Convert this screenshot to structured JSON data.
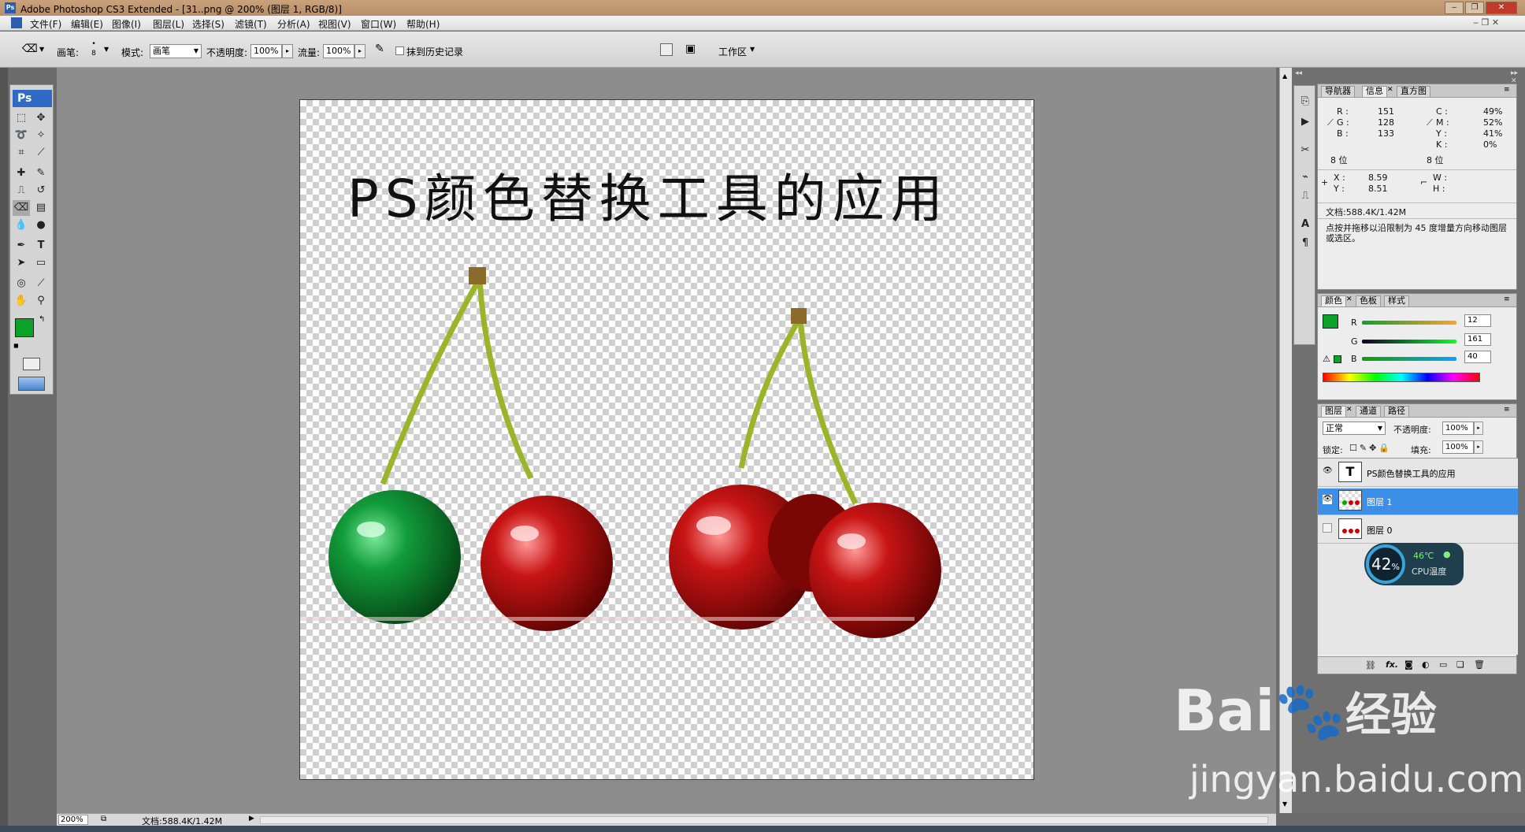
{
  "window": {
    "title": "Adobe Photoshop CS3 Extended - [31..png @ 200% (图层 1, RGB/8)]",
    "app_icon": "Ps",
    "buttons": [
      "‒",
      "❐",
      "✕"
    ]
  },
  "menu": [
    "文件(F)",
    "编辑(E)",
    "图像(I)",
    "图层(L)",
    "选择(S)",
    "滤镜(T)",
    "分析(A)",
    "视图(V)",
    "窗口(W)",
    "帮助(H)"
  ],
  "options": {
    "brush_label": "画笔:",
    "brush_size": "8",
    "mode_label": "模式:",
    "mode_value": "画笔",
    "opacity_label": "不透明度:",
    "opacity_value": "100%",
    "flow_label": "流量:",
    "flow_value": "100%",
    "erase_history_label": "抹到历史记录",
    "workspace_label": "工作区"
  },
  "toolbox": {
    "badge": "Ps"
  },
  "canvas": {
    "heading": "PS颜色替换工具的应用"
  },
  "status": {
    "zoom": "200%",
    "doc": "文档:588.4K/1.42M"
  },
  "info_panel": {
    "tabs": [
      "导航器",
      "信息",
      "直方图"
    ],
    "r_label": "R :",
    "r_value": "151",
    "g_label": "G :",
    "g_value": "128",
    "b_label": "B :",
    "b_value": "133",
    "c_label": "C :",
    "c_value": "49%",
    "m_label": "M :",
    "m_value": "52%",
    "y_label": "Y :",
    "y_value": "41%",
    "k_label": "K :",
    "k_value": "0%",
    "bits_left": "8 位",
    "bits_right": "8 位",
    "x_label": "X :",
    "x_value": "8.59",
    "y2_label": "Y :",
    "y2_value": "8.51",
    "w_label": "W :",
    "h_label": "H :",
    "doc": "文档:588.4K/1.42M",
    "hint": "点按并拖移以沿限制为 45 度增量方向移动图层或选区。"
  },
  "color_panel": {
    "tabs": [
      "颜色",
      "色板",
      "样式"
    ],
    "r_label": "R",
    "r_value": "12",
    "g_label": "G",
    "g_value": "161",
    "b_label": "B",
    "b_value": "40",
    "foreground": "#0ca128"
  },
  "layers_panel": {
    "tabs": [
      "图层",
      "通道",
      "路径"
    ],
    "blend_mode": "正常",
    "opacity_label": "不透明度:",
    "opacity_value": "100%",
    "lock_label": "锁定:",
    "fill_label": "填充:",
    "fill_value": "100%",
    "layers": [
      {
        "name": "PS颜色替换工具的应用",
        "type": "text",
        "visible": true,
        "selected": false
      },
      {
        "name": "图层 1",
        "type": "pixel",
        "visible": true,
        "selected": true
      },
      {
        "name": "图层 0",
        "type": "pixel",
        "visible": false,
        "selected": false
      }
    ]
  },
  "cpu_widget": {
    "percent": "42",
    "percent_sign": "%",
    "temp": "46℃",
    "label": "CPU温度"
  },
  "watermark": {
    "logo": "Bai",
    "logo_cn": "经验",
    "url": "jingyan.baidu.com"
  }
}
